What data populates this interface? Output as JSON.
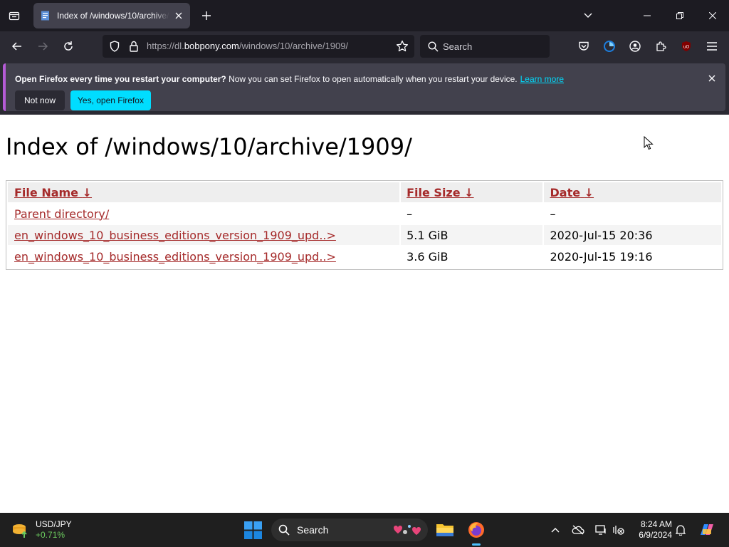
{
  "browser": {
    "tab": {
      "title": "Index of /windows/10/archive/1909/"
    },
    "url": {
      "prefix": "https://dl.",
      "host": "bobpony.com",
      "path": "/windows/10/archive/1909/"
    },
    "search_placeholder": "Search"
  },
  "notification": {
    "bold_text": "Open Firefox every time you restart your computer?",
    "text": " Now you can set Firefox to open automatically when you restart your device.",
    "learn_more": "Learn more",
    "not_now_label": "Not now",
    "yes_label": "Yes, open Firefox",
    "accent_color": "#00ddff"
  },
  "page": {
    "title": "Index of /windows/10/archive/1909/",
    "columns": [
      {
        "label": "File Name",
        "sort_arrow": "↓"
      },
      {
        "label": "File Size",
        "sort_arrow": "↓"
      },
      {
        "label": "Date",
        "sort_arrow": "↓"
      }
    ],
    "rows": [
      {
        "name": "Parent directory/",
        "size": "–",
        "date": "–"
      },
      {
        "name": "en_windows_10_business_editions_version_1909_upd..>",
        "size": "5.1 GiB",
        "date": "2020-Jul-15 20:36"
      },
      {
        "name": "en_windows_10_business_editions_version_1909_upd..>",
        "size": "3.6 GiB",
        "date": "2020-Jul-15 19:16"
      }
    ],
    "link_color": "#a52a2a"
  },
  "taskbar": {
    "widget": {
      "name": "USD/JPY",
      "change": "+0.71%"
    },
    "search_label": "Search",
    "clock": {
      "time": "8:24 AM",
      "date": "6/9/2024"
    }
  }
}
